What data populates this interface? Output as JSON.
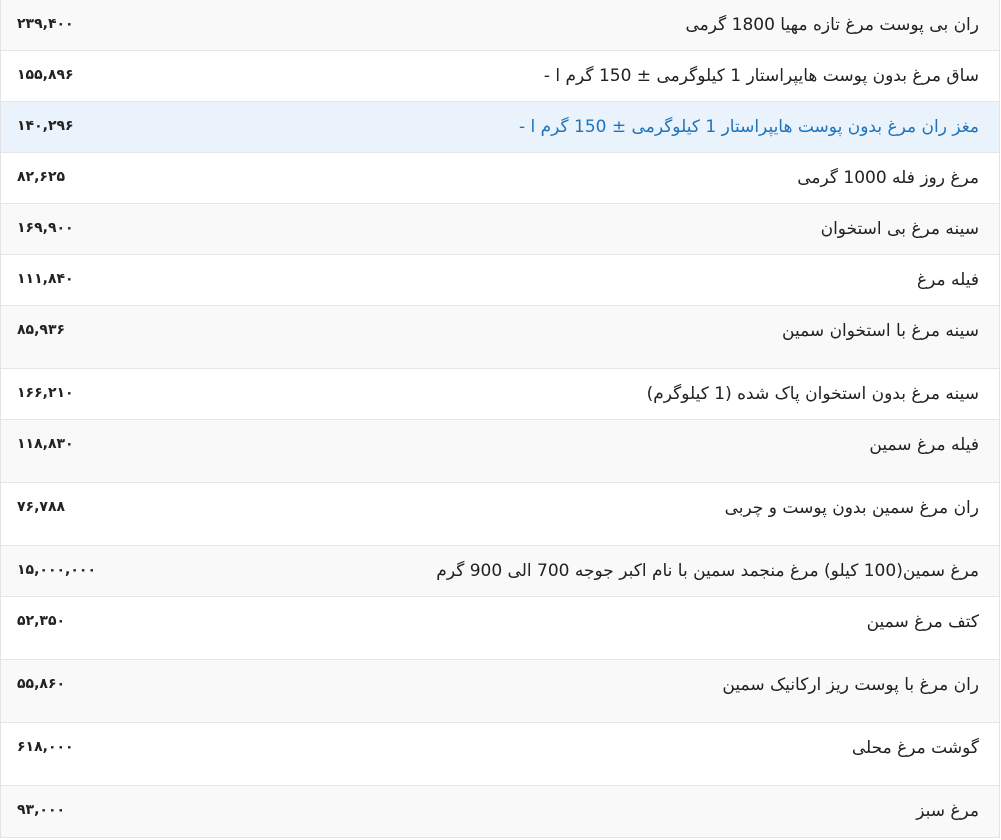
{
  "colors": {
    "link_text": "#1e73be",
    "highlight_row_bg": "#eaf3fb",
    "striped_row_bg": "#f9f9f9"
  },
  "products": [
    {
      "name": "ران بی پوست مرغ تازه مهیا 1800 گرمی",
      "price": "۲۳۹,۴۰۰"
    },
    {
      "name": "ساق مرغ بدون پوست هایپراستار 1 کیلوگرمی ± 150 گرم ا -",
      "price": "۱۵۵,۸۹۶"
    },
    {
      "name": "مغز ران مرغ بدون پوست هایپراستار 1 کیلوگرمی ± 150 گرم ا -",
      "price": "۱۴۰,۲۹۶"
    },
    {
      "name": "مرغ روز فله 1000 گرمی",
      "price": "۸۲,۶۲۵"
    },
    {
      "name": "سینه مرغ بی استخوان",
      "price": "۱۶۹,۹۰۰"
    },
    {
      "name": "فیله مرغ",
      "price": "۱۱۱,۸۴۰"
    },
    {
      "name": "سینه مرغ با استخوان سمین",
      "price": "۸۵,۹۳۶"
    },
    {
      "name": "سینه مرغ بدون استخوان پاک شده (1 کیلوگرم)",
      "price": "۱۶۶,۲۱۰"
    },
    {
      "name": "فیله مرغ سمین",
      "price": "۱۱۸,۸۳۰"
    },
    {
      "name": "ران مرغ سمین بدون پوست و چربی",
      "price": "۷۶,۷۸۸"
    },
    {
      "name": "مرغ سمین(100 کیلو) مرغ منجمد سمین با نام اکبر جوجه 700 الی 900 گرم",
      "price": "۱۵,۰۰۰,۰۰۰"
    },
    {
      "name": "کتف مرغ سمین",
      "price": "۵۲,۳۵۰"
    },
    {
      "name": "ران مرغ با پوست ریز ارکانیک سمین",
      "price": "۵۵,۸۶۰"
    },
    {
      "name": "گوشت مرغ محلی",
      "price": "۶۱۸,۰۰۰"
    },
    {
      "name": "مرغ سبز",
      "price": "۹۳,۰۰۰"
    }
  ]
}
